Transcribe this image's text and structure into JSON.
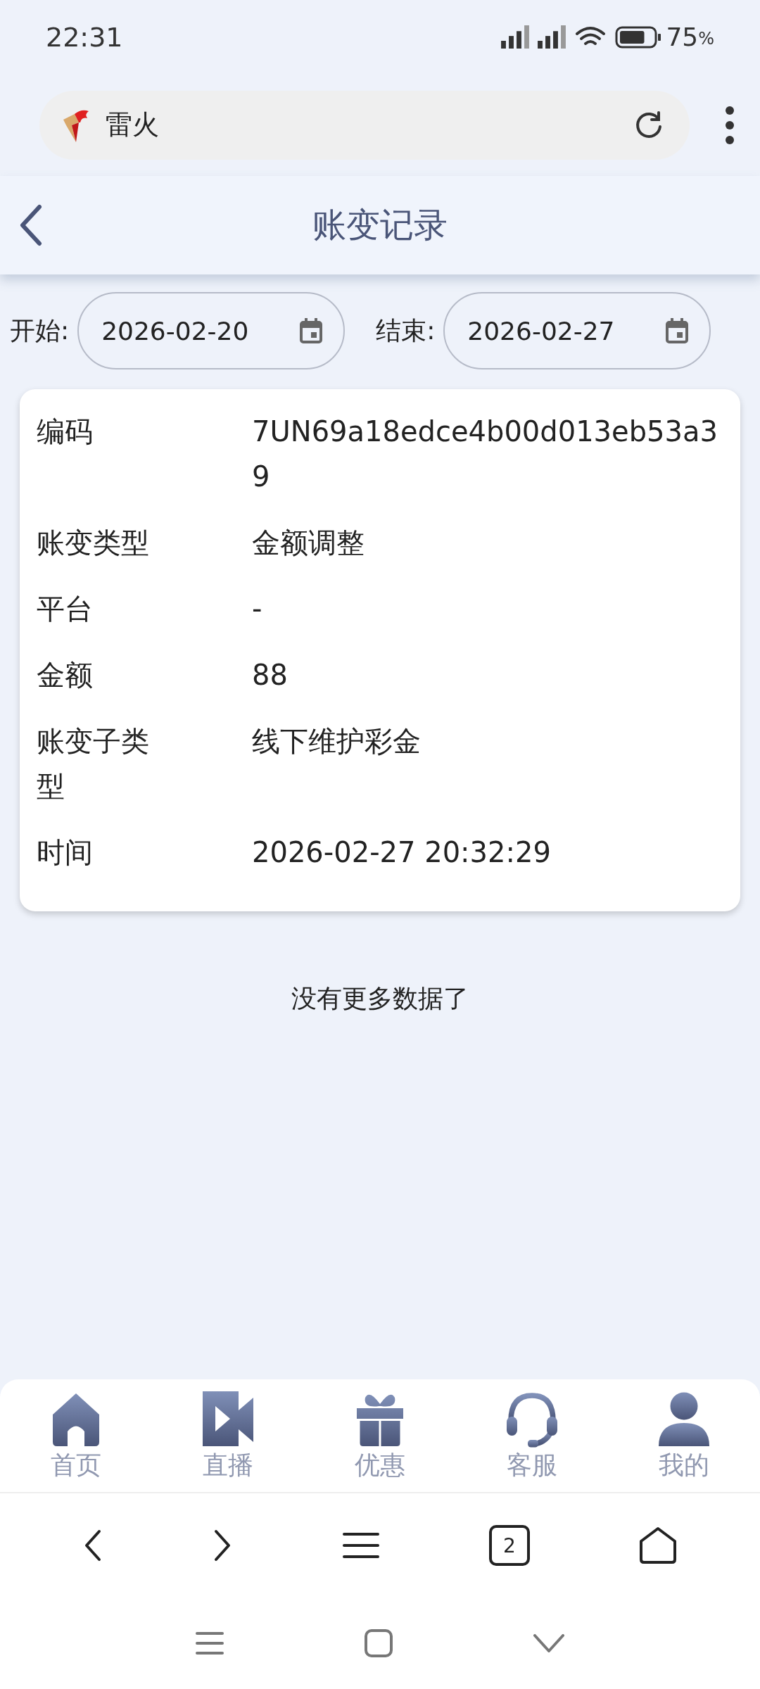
{
  "status_bar": {
    "time": "22:31",
    "battery": "75",
    "battery_unit": "%"
  },
  "address_bar": {
    "title": "雷火"
  },
  "header": {
    "title": "账变记录"
  },
  "filters": [
    {
      "label": "开始:",
      "value": "2026-02-20"
    },
    {
      "label": "结束:",
      "value": "2026-02-27"
    }
  ],
  "records": [
    {
      "fields": [
        {
          "label": "编码",
          "value": "7UN69a18edce4b00d013eb53a39"
        },
        {
          "label": "账变类型",
          "value": "金额调整"
        },
        {
          "label": "平台",
          "value": "-"
        },
        {
          "label": "金额",
          "value": "88"
        },
        {
          "label": "账变子类型",
          "value": "线下维护彩金"
        },
        {
          "label": "时间",
          "value": "2026-02-27 20:32:29"
        }
      ]
    }
  ],
  "end_message": "没有更多数据了",
  "bottom_nav": [
    {
      "label": "首页"
    },
    {
      "label": "直播"
    },
    {
      "label": "优惠"
    },
    {
      "label": "客服"
    },
    {
      "label": "我的"
    }
  ],
  "browser_bar": {
    "tab_count": "2"
  }
}
